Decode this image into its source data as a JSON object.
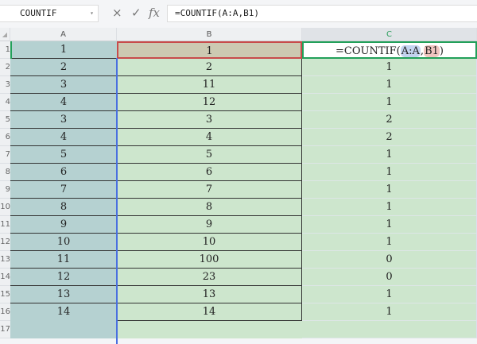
{
  "formula_bar": {
    "name_box": "COUNTIF",
    "formula": "=COUNTIF(A:A,B1)",
    "cancel_icon": "×",
    "accept_icon": "✓",
    "fx_label": "fx"
  },
  "columns": [
    "A",
    "B",
    "C"
  ],
  "edit_cell": {
    "prefix": "=COUNTIF(",
    "range": "A:A",
    "sep": ",",
    "ref": "B1",
    "suffix": ")"
  },
  "rows": [
    {
      "n": "1",
      "a": "1",
      "b": "1",
      "c": ""
    },
    {
      "n": "2",
      "a": "2",
      "b": "2",
      "c": "1"
    },
    {
      "n": "3",
      "a": "3",
      "b": "11",
      "c": "1"
    },
    {
      "n": "4",
      "a": "4",
      "b": "12",
      "c": "1"
    },
    {
      "n": "5",
      "a": "3",
      "b": "3",
      "c": "2"
    },
    {
      "n": "6",
      "a": "4",
      "b": "4",
      "c": "2"
    },
    {
      "n": "7",
      "a": "5",
      "b": "5",
      "c": "1"
    },
    {
      "n": "8",
      "a": "6",
      "b": "6",
      "c": "1"
    },
    {
      "n": "9",
      "a": "7",
      "b": "7",
      "c": "1"
    },
    {
      "n": "10",
      "a": "8",
      "b": "8",
      "c": "1"
    },
    {
      "n": "11",
      "a": "9",
      "b": "9",
      "c": "1"
    },
    {
      "n": "12",
      "a": "10",
      "b": "10",
      "c": "1"
    },
    {
      "n": "13",
      "a": "11",
      "b": "100",
      "c": "0"
    },
    {
      "n": "14",
      "a": "12",
      "b": "23",
      "c": "0"
    },
    {
      "n": "15",
      "a": "13",
      "b": "13",
      "c": "1"
    },
    {
      "n": "16",
      "a": "14",
      "b": "14",
      "c": "1"
    },
    {
      "n": "17",
      "a": "",
      "b": "",
      "c": ""
    }
  ]
}
